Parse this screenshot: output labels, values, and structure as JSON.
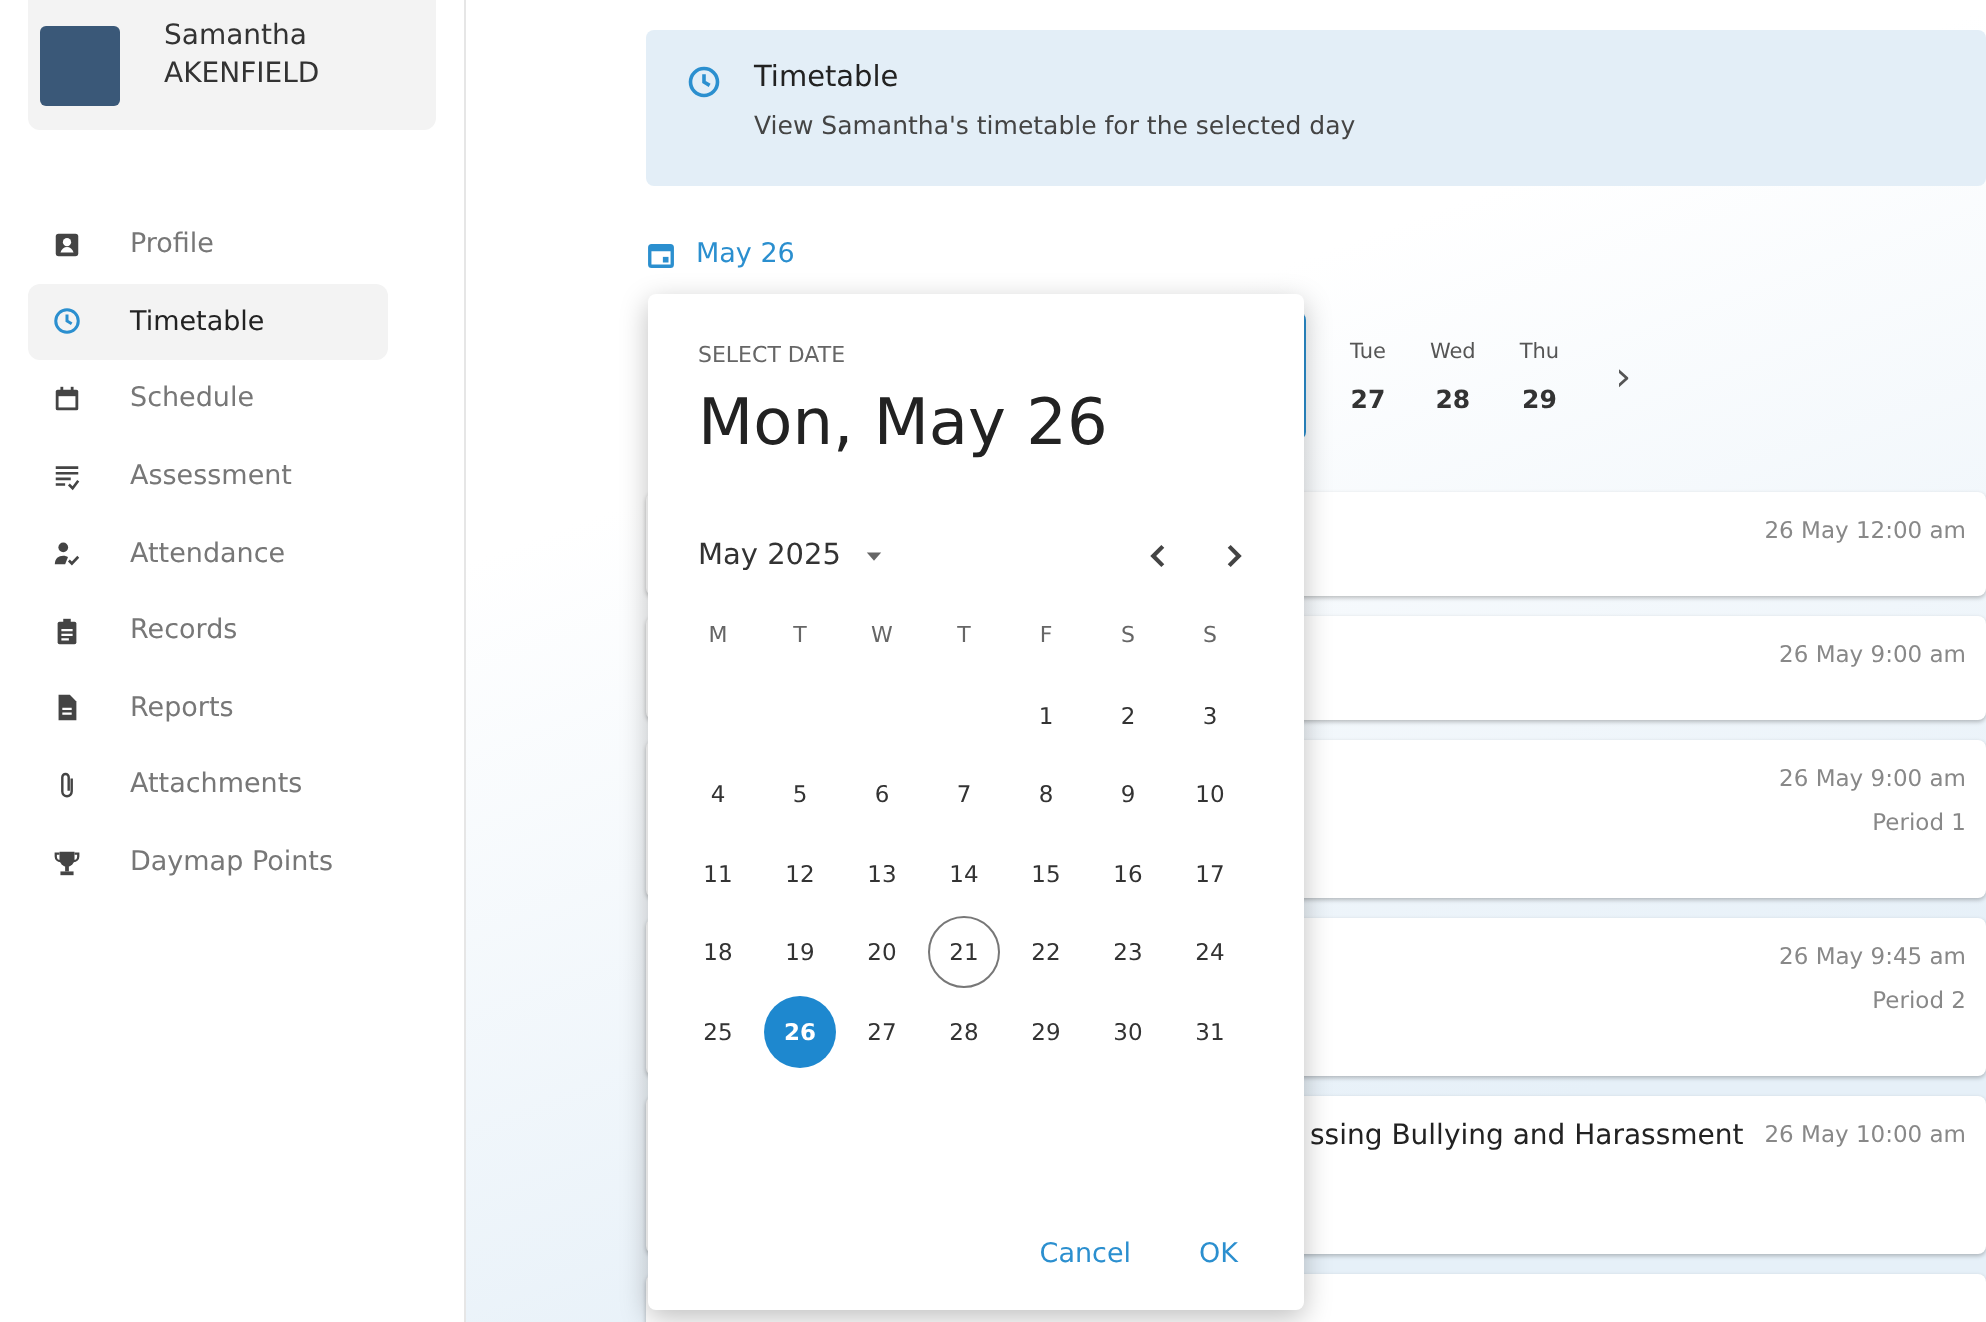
{
  "profile": {
    "first_name": "Samantha",
    "last_name": "AKENFIELD"
  },
  "sidebar": {
    "items": [
      {
        "label": "Profile",
        "selected": false
      },
      {
        "label": "Timetable",
        "selected": true
      },
      {
        "label": "Schedule",
        "selected": false
      },
      {
        "label": "Assessment",
        "selected": false
      },
      {
        "label": "Attendance",
        "selected": false
      },
      {
        "label": "Records",
        "selected": false
      },
      {
        "label": "Reports",
        "selected": false
      },
      {
        "label": "Attachments",
        "selected": false
      },
      {
        "label": "Daymap Points",
        "selected": false
      }
    ]
  },
  "header": {
    "title": "Timetable",
    "subtitle": "View Samantha's timetable for the selected day"
  },
  "date_button": "May 26",
  "day_strip": {
    "days": [
      {
        "name": "Tue",
        "date": "27"
      },
      {
        "name": "Wed",
        "date": "28"
      },
      {
        "name": "Thu",
        "date": "29"
      }
    ],
    "next": "›"
  },
  "events": [
    {
      "time": "26 May 12:00 am"
    },
    {
      "time": "26 May 9:00 am"
    },
    {
      "time": "26 May 9:00 am",
      "period": "Period 1"
    },
    {
      "time": "26 May 9:45 am",
      "period": "Period 2"
    },
    {
      "title": "ssing Bullying and Harassment",
      "time": "26 May 10:00 am"
    }
  ],
  "date_picker": {
    "label": "SELECT DATE",
    "heading": "Mon, May 26",
    "month": "May 2025",
    "weekdays": [
      "M",
      "T",
      "W",
      "T",
      "F",
      "S",
      "S"
    ],
    "weeks": [
      [
        {
          "label": "1",
          "selected": false,
          "today": false
        },
        {
          "label": "2",
          "selected": false,
          "today": false
        },
        {
          "label": "3",
          "selected": false,
          "today": false
        }
      ],
      [
        {
          "label": "4",
          "selected": false,
          "today": false
        },
        {
          "label": "5",
          "selected": false,
          "today": false
        },
        {
          "label": "6",
          "selected": false,
          "today": false
        },
        {
          "label": "7",
          "selected": false,
          "today": false
        },
        {
          "label": "8",
          "selected": false,
          "today": false
        },
        {
          "label": "9",
          "selected": false,
          "today": false
        },
        {
          "label": "10",
          "selected": false,
          "today": false
        }
      ],
      [
        {
          "label": "11",
          "selected": false,
          "today": false
        },
        {
          "label": "12",
          "selected": false,
          "today": false
        },
        {
          "label": "13",
          "selected": false,
          "today": false
        },
        {
          "label": "14",
          "selected": false,
          "today": false
        },
        {
          "label": "15",
          "selected": false,
          "today": false
        },
        {
          "label": "16",
          "selected": false,
          "today": false
        },
        {
          "label": "17",
          "selected": false,
          "today": false
        }
      ],
      [
        {
          "label": "18",
          "selected": false,
          "today": false
        },
        {
          "label": "19",
          "selected": false,
          "today": false
        },
        {
          "label": "20",
          "selected": false,
          "today": false
        },
        {
          "label": "21",
          "selected": false,
          "today": true
        },
        {
          "label": "22",
          "selected": false,
          "today": false
        },
        {
          "label": "23",
          "selected": false,
          "today": false
        },
        {
          "label": "24",
          "selected": false,
          "today": false
        }
      ],
      [
        {
          "label": "25",
          "selected": false,
          "today": false
        },
        {
          "label": "26",
          "selected": true,
          "today": false
        },
        {
          "label": "27",
          "selected": false,
          "today": false
        },
        {
          "label": "28",
          "selected": false,
          "today": false
        },
        {
          "label": "29",
          "selected": false,
          "today": false
        },
        {
          "label": "30",
          "selected": false,
          "today": false
        },
        {
          "label": "31",
          "selected": false,
          "today": false
        }
      ]
    ],
    "buttons": [
      "Cancel",
      "OK"
    ]
  }
}
